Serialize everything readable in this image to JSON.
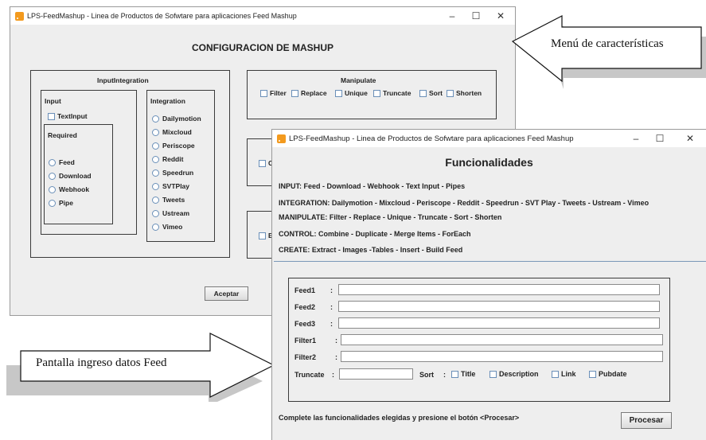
{
  "config_window": {
    "title": "LPS-FeedMashup - Linea de Productos de Sofwtare para aplicaciones Feed Mashup",
    "heading": "CONFIGURACION DE MASHUP",
    "input_integration_label": "InputIntegration",
    "input_label": "Input",
    "text_input": "TextInput",
    "required_label": "Required",
    "required_items": [
      "Feed",
      "Download",
      "Webhook",
      "Pipe"
    ],
    "integration_label": "Integration",
    "integration_items": [
      "Dailymotion",
      "Mixcloud",
      "Periscope",
      "Reddit",
      "Speedrun",
      "SVTPlay",
      "Tweets",
      "Ustream",
      "Vimeo"
    ],
    "manipulate_label": "Manipulate",
    "manipulate_items": [
      "Filter",
      "Replace",
      "Unique",
      "Truncate",
      "Sort",
      "Shorten"
    ],
    "partial_c": "C",
    "partial_e": "E",
    "accept_button": "Aceptar"
  },
  "func_window": {
    "title": "LPS-FeedMashup - Linea de Productos de Sofwtare para aplicaciones Feed Mashup",
    "heading": "Funcionalidades",
    "lines": [
      "INPUT: Feed - Download - Webhook - Text Input - Pipes",
      "INTEGRATION: Dailymotion - Mixcloud - Periscope - Reddit - Speedrun - SVT Play - Tweets - Ustream - Vimeo",
      "MANIPULATE: Filter - Replace - Unique - Truncate - Sort - Shorten",
      "CONTROL: Combine - Duplicate - Merge Items - ForEach",
      "CREATE: Extract - Images -Tables - Insert - Build Feed"
    ],
    "fields": [
      "Feed1",
      "Feed2",
      "Feed3",
      "Filter1",
      "Filter2"
    ],
    "colon": ":",
    "truncate_label": "Truncate",
    "sort_label": "Sort",
    "sort_options": [
      "Title",
      "Description",
      "Link",
      "Pubdate"
    ],
    "footer": "Complete las funcionalidades elegidas y presione el botón <Procesar>",
    "process_button": "Procesar"
  },
  "window_buttons": {
    "minimize": "–",
    "maximize": "☐",
    "close": "✕"
  },
  "callouts": {
    "menu": "Menú de características",
    "screen": "Pantalla ingreso datos Feed"
  }
}
